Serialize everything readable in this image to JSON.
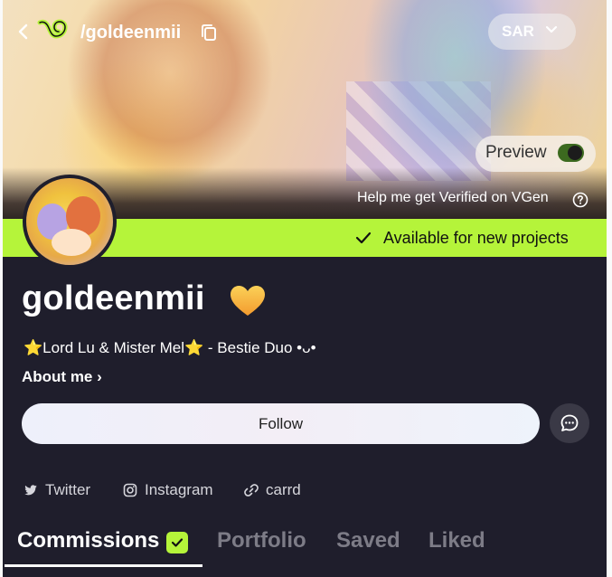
{
  "header": {
    "handle": "/goldeenmii",
    "currency": "SAR",
    "icons": [
      "back-arrow-icon",
      "vgen-logo-icon",
      "copy-icon",
      "chevron-down-icon"
    ]
  },
  "banner": {
    "preview_label": "Preview",
    "preview_on": true,
    "verify_text": "Help me get Verified on VGen",
    "availability": "Available for new projects"
  },
  "profile": {
    "name": "goldeenmii",
    "bio_prefix": "⭐",
    "bio_main": "Lord Lu & Mister Mel",
    "bio_star2": "⭐",
    "bio_suffix": " - Bestie Duo •ᴗ•",
    "about_label": "About me ›",
    "follow_label": "Follow"
  },
  "socials": [
    {
      "label": "Twitter",
      "icon": "twitter-icon"
    },
    {
      "label": "Instagram",
      "icon": "instagram-icon"
    },
    {
      "label": "carrd",
      "icon": "link-icon"
    }
  ],
  "tabs": [
    {
      "label": "Commissions",
      "active": true
    },
    {
      "label": "Portfolio",
      "active": false
    },
    {
      "label": "Saved",
      "active": false
    },
    {
      "label": "Liked",
      "active": false
    }
  ],
  "colors": {
    "accent": "#b5f43a",
    "background": "#1f1e2c",
    "heart": "#f6b538"
  }
}
